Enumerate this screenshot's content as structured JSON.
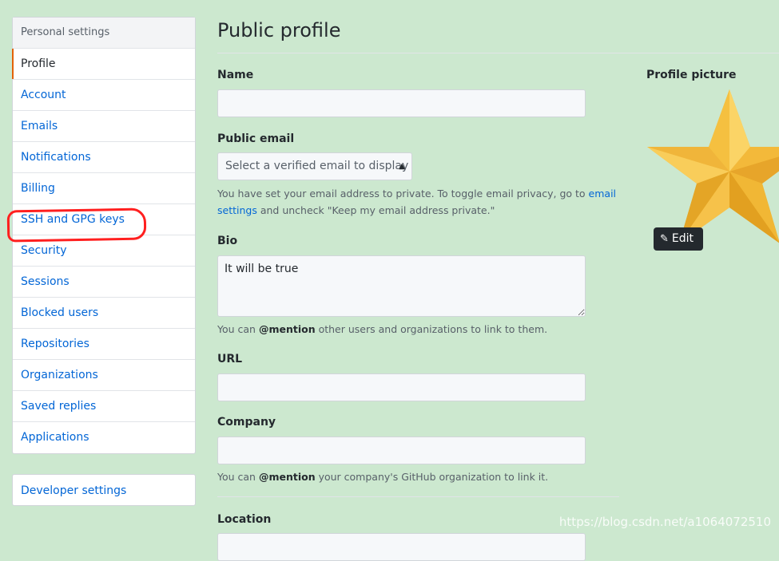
{
  "sidebar": {
    "heading": "Personal settings",
    "items": [
      {
        "label": "Profile"
      },
      {
        "label": "Account"
      },
      {
        "label": "Emails"
      },
      {
        "label": "Notifications"
      },
      {
        "label": "Billing"
      },
      {
        "label": "SSH and GPG keys"
      },
      {
        "label": "Security"
      },
      {
        "label": "Sessions"
      },
      {
        "label": "Blocked users"
      },
      {
        "label": "Repositories"
      },
      {
        "label": "Organizations"
      },
      {
        "label": "Saved replies"
      },
      {
        "label": "Applications"
      }
    ],
    "developer_settings": "Developer settings",
    "annotation_color": "#ff1f1f"
  },
  "main": {
    "title": "Public profile",
    "name": {
      "label": "Name",
      "value": ""
    },
    "public_email": {
      "label": "Public email",
      "selected": "Select a verified email to display",
      "note_pre": "You have set your email address to private. To toggle email privacy, go to ",
      "note_link": "email settings",
      "note_post": " and uncheck \"Keep my email address private.\""
    },
    "bio": {
      "label": "Bio",
      "value": "It will be true",
      "note_pre": "You can ",
      "note_mention": "@mention",
      "note_post": " other users and organizations to link to them."
    },
    "url": {
      "label": "URL",
      "value": ""
    },
    "company": {
      "label": "Company",
      "value": "",
      "note_pre": "You can ",
      "note_mention": "@mention",
      "note_post": " your company's GitHub organization to link it."
    },
    "location": {
      "label": "Location"
    }
  },
  "profile_picture": {
    "label": "Profile picture",
    "edit_label": "Edit",
    "edit_icon": "pencil-icon",
    "avatar_icon": "star-icon"
  },
  "watermark": "https://blog.csdn.net/a1064072510",
  "colors": {
    "link": "#0366d6",
    "background": "#cce8cf",
    "selected_indicator": "#e36209",
    "star": "#f2b632"
  }
}
